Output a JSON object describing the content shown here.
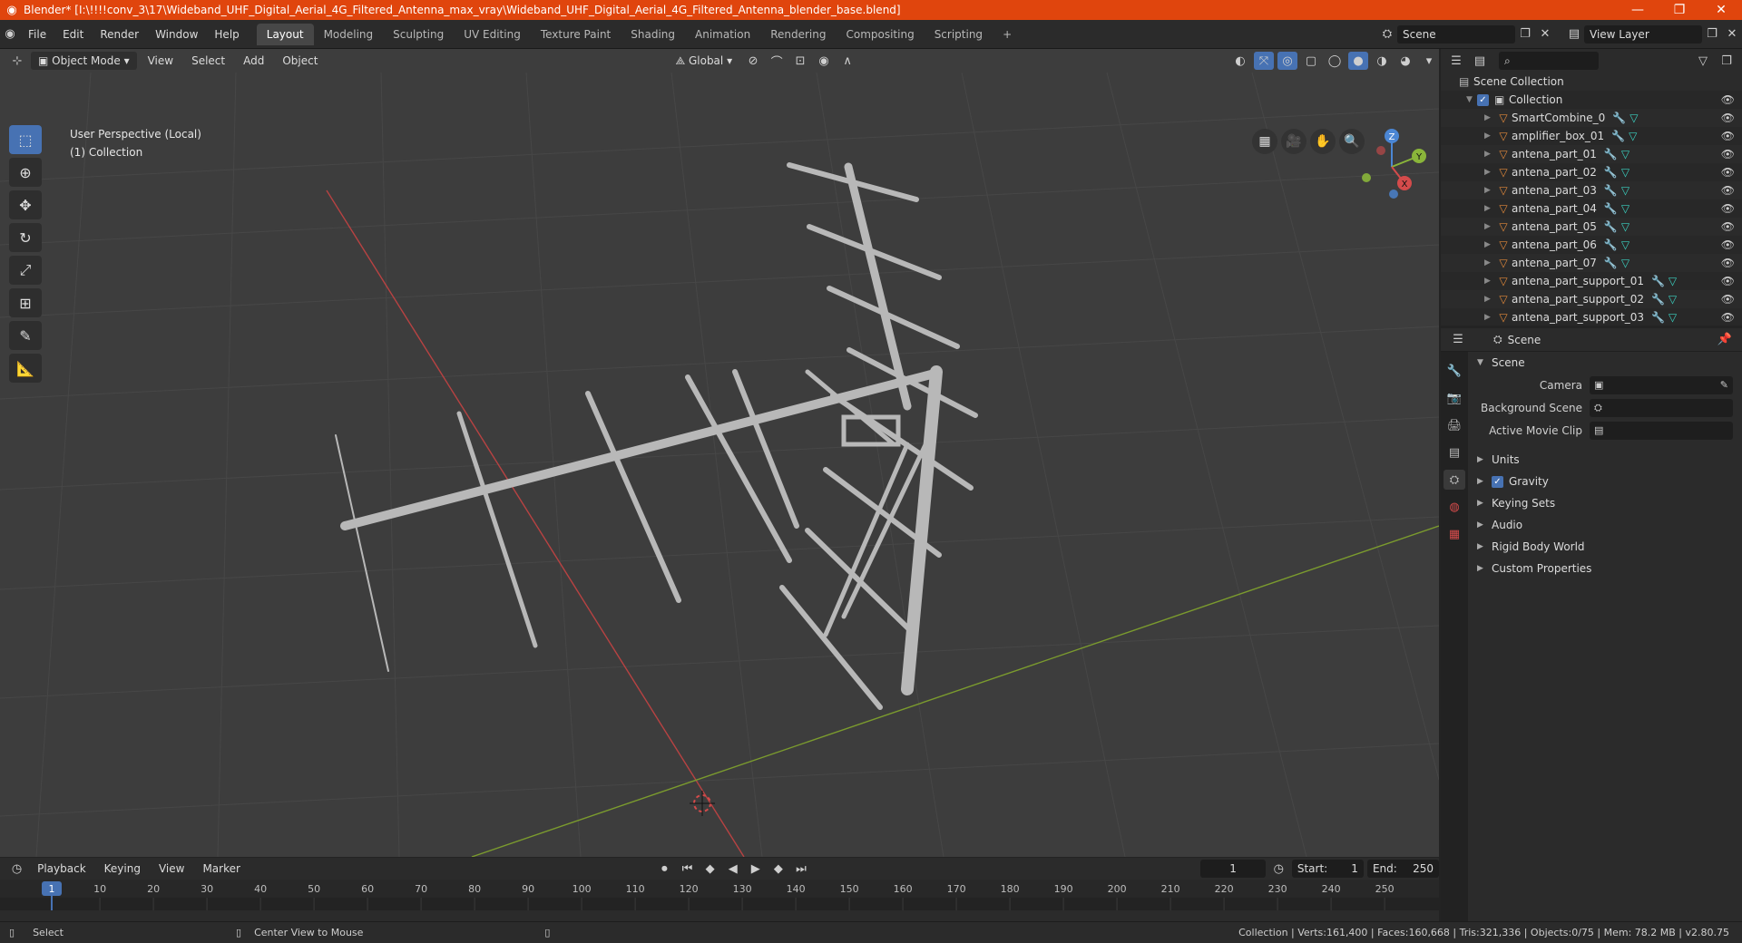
{
  "title_bar": {
    "title": "Blender* [I:\\!!!!conv_3\\17\\Wideband_UHF_Digital_Aerial_4G_Filtered_Antenna_max_vray\\Wideband_UHF_Digital_Aerial_4G_Filtered_Antenna_blender_base.blend]",
    "minimize": "—",
    "maximize": "❐",
    "close": "✕"
  },
  "menu": [
    "File",
    "Edit",
    "Render",
    "Window",
    "Help"
  ],
  "workspaces": [
    "Layout",
    "Modeling",
    "Sculpting",
    "UV Editing",
    "Texture Paint",
    "Shading",
    "Animation",
    "Rendering",
    "Compositing",
    "Scripting"
  ],
  "workspace_add": "+",
  "scene_field": "Scene",
  "view_layer_field": "View Layer",
  "viewport": {
    "mode": "Object Mode",
    "menus": [
      "View",
      "Select",
      "Add",
      "Object"
    ],
    "transform_orientation": "Global",
    "info_line1": "User Perspective (Local)",
    "info_line2": "(1) Collection",
    "gizmo_axes": {
      "x": "X",
      "y": "Y",
      "z": "Z"
    }
  },
  "outliner": {
    "root": "Scene Collection",
    "collection": "Collection",
    "items": [
      "SmartCombine_0",
      "amplifier_box_01",
      "antena_part_01",
      "antena_part_02",
      "antena_part_03",
      "antena_part_04",
      "antena_part_05",
      "antena_part_06",
      "antena_part_07",
      "antena_part_support_01",
      "antena_part_support_02",
      "antena_part_support_03"
    ]
  },
  "properties": {
    "header": "Scene",
    "section": "Scene",
    "fields": [
      {
        "label": "Camera"
      },
      {
        "label": "Background Scene"
      },
      {
        "label": "Active Movie Clip"
      }
    ],
    "panels": [
      "Units",
      "Gravity",
      "Keying Sets",
      "Audio",
      "Rigid Body World",
      "Custom Properties"
    ]
  },
  "timeline": {
    "menus": [
      "Playback",
      "Keying",
      "View",
      "Marker"
    ],
    "current_frame": "1",
    "start_label": "Start:",
    "start": "1",
    "end_label": "End:",
    "end": "250",
    "ticks": [
      "1",
      "10",
      "20",
      "30",
      "40",
      "50",
      "60",
      "70",
      "80",
      "90",
      "100",
      "110",
      "120",
      "130",
      "140",
      "150",
      "160",
      "170",
      "180",
      "190",
      "200",
      "210",
      "220",
      "230",
      "240",
      "250"
    ]
  },
  "status_bar": {
    "left": "Select",
    "middle": "Center View to Mouse",
    "right": "Collection | Verts:161,400 | Faces:160,668 | Tris:321,336 | Objects:0/75 | Mem: 78.2 MB | v2.80.75"
  },
  "colors": {
    "title_bar": "#e0450d",
    "accent": "#4772b3",
    "x_axis": "#d44b4b",
    "y_axis": "#8ab53a",
    "z_axis": "#4b86d4"
  }
}
